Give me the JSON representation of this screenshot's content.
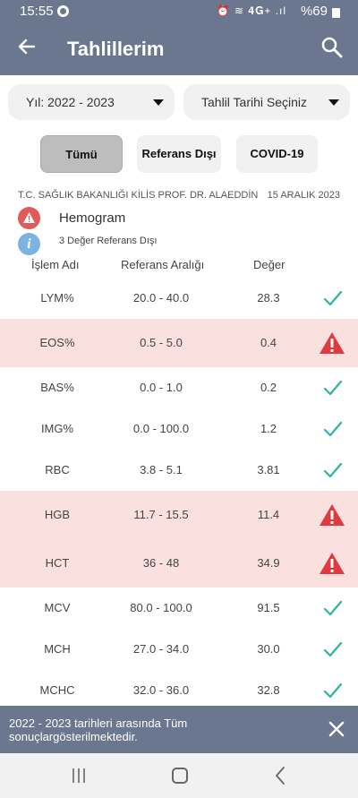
{
  "status": {
    "time": "15:55",
    "icons": "⏰ ≋ 𝟒𝐆+ .ıl",
    "battery": "%69"
  },
  "appbar": {
    "title": "Tahlillerim"
  },
  "filters": {
    "year_select": "Yıl: 2022 - 2023",
    "date_select": "Tahlil Tarihi Seçiniz"
  },
  "segments": {
    "all": "Tümü",
    "ref_out": "Referans Dışı",
    "covid": "COVID-19"
  },
  "report": {
    "hospital": "T.C. SAĞLIK BAKANLIĞI KİLİS PROF. DR. ALAEDDİN",
    "date": "15 ARALIK 2023",
    "test_name": "Hemogram",
    "note": "3 Değer Referans Dışı",
    "warn_glyph": "!",
    "info_glyph": "i"
  },
  "table": {
    "headers": {
      "name": "İşlem Adı",
      "range": "Referans Aralığı",
      "value": "Değer"
    },
    "rows": [
      {
        "name": "LYM%",
        "range": "20.0 - 40.0",
        "value": "28.3",
        "status": "ok"
      },
      {
        "name": "EOS%",
        "range": "0.5 - 5.0",
        "value": "0.4",
        "status": "out"
      },
      {
        "name": "BAS%",
        "range": "0.0 - 1.0",
        "value": "0.2",
        "status": "ok"
      },
      {
        "name": "IMG%",
        "range": "0.0 - 100.0",
        "value": "1.2",
        "status": "ok"
      },
      {
        "name": "RBC",
        "range": "3.8 - 5.1",
        "value": "3.81",
        "status": "ok"
      },
      {
        "name": "HGB",
        "range": "11.7 - 15.5",
        "value": "11.4",
        "status": "out"
      },
      {
        "name": "HCT",
        "range": "36 - 48",
        "value": "34.9",
        "status": "out"
      },
      {
        "name": "MCV",
        "range": "80.0 - 100.0",
        "value": "91.5",
        "status": "ok"
      },
      {
        "name": "MCH",
        "range": "27.0 - 34.0",
        "value": "30.0",
        "status": "ok"
      },
      {
        "name": "MCHC",
        "range": "32.0 - 36.0",
        "value": "32.8",
        "status": "ok"
      }
    ]
  },
  "banner": {
    "text": "2022 - 2023 tarihleri arasında Tüm sonuçlargösterilmektedir."
  },
  "colors": {
    "header": "#6b778e",
    "out_row": "#fbe0e0",
    "ok": "#2bb5a0",
    "warn": "#e0393e"
  }
}
